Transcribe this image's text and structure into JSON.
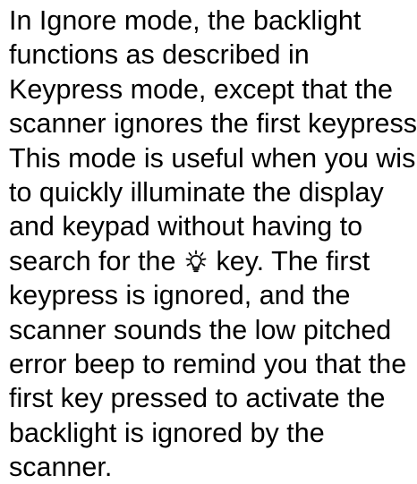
{
  "paragraph": {
    "lines": [
      "In Ignore mode, the backlight",
      "functions as described in",
      "Keypress mode, except that the",
      "scanner ignores the first keypress.",
      "This mode is useful when you wish",
      "to quickly illuminate the display",
      "and keypad without having to"
    ],
    "line_8_before_icon": "search for the",
    "line_8_icon": "backlight-bulb-icon",
    "line_8_after_icon": "key. The first",
    "lines_after": [
      "keypress is ignored, and the",
      "scanner sounds the low pitched",
      "error beep to remind you that the",
      "first key pressed to activate the",
      "backlight is ignored by the",
      "scanner."
    ]
  }
}
